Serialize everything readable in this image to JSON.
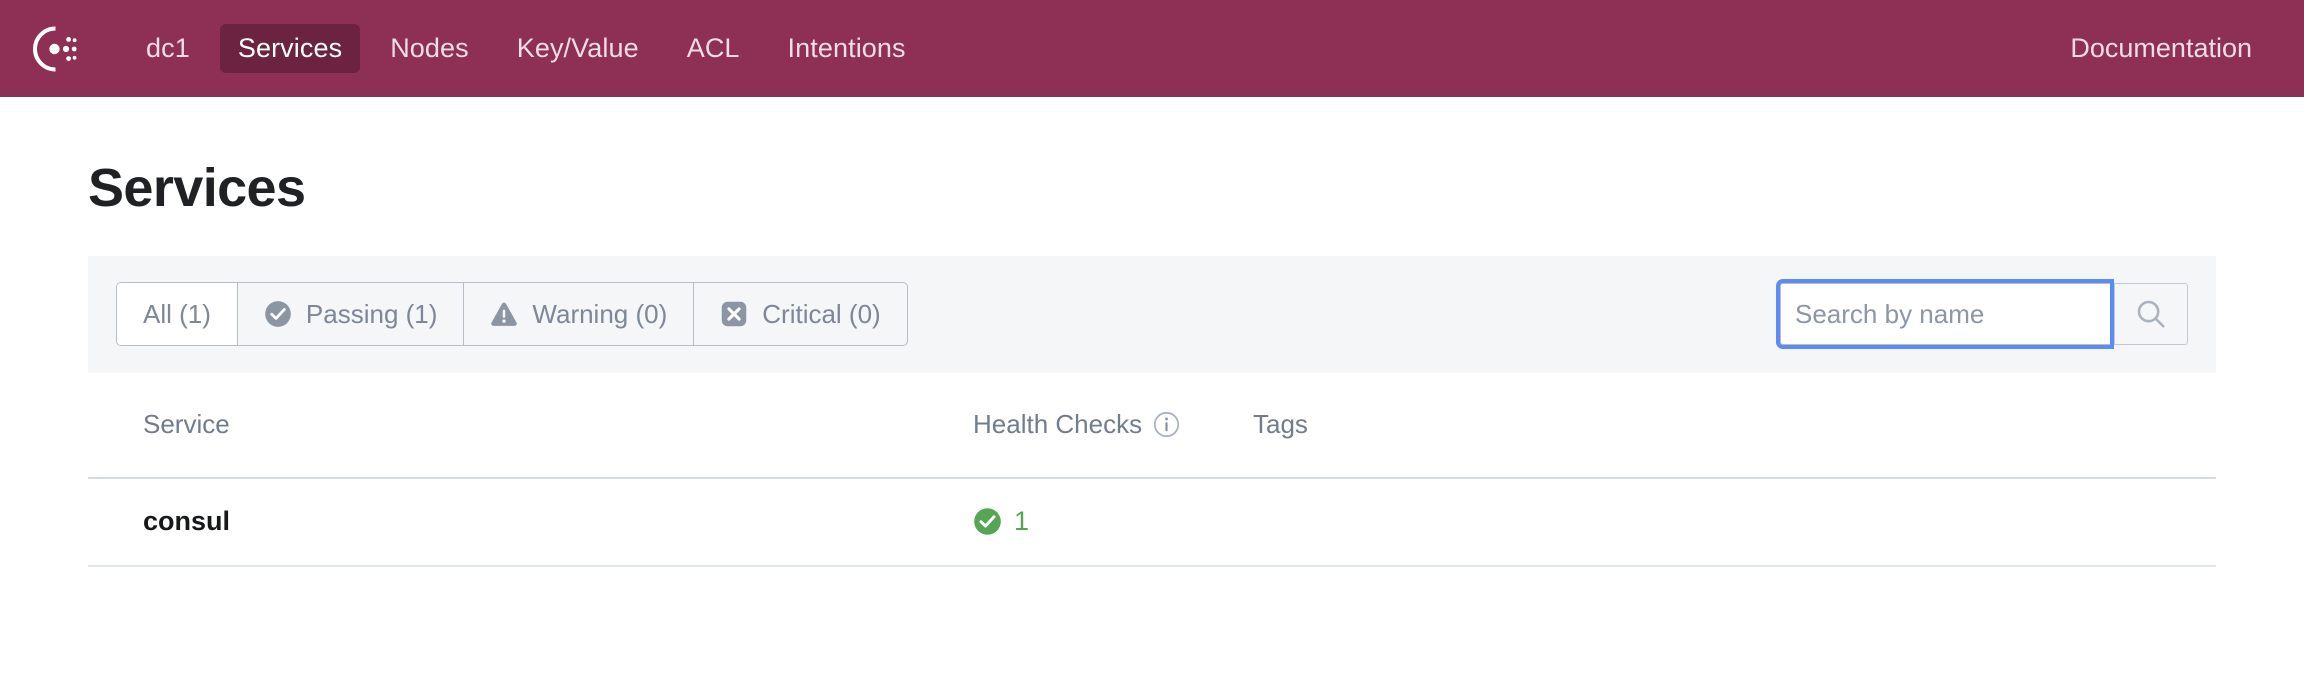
{
  "nav": {
    "logo_icon": "consul-logo-icon",
    "items": [
      {
        "label": "dc1",
        "active": false
      },
      {
        "label": "Services",
        "active": true
      },
      {
        "label": "Nodes",
        "active": false
      },
      {
        "label": "Key/Value",
        "active": false
      },
      {
        "label": "ACL",
        "active": false
      },
      {
        "label": "Intentions",
        "active": false
      }
    ],
    "documentation_label": "Documentation",
    "bar_color": "#8e2f56",
    "active_color": "#6b2341"
  },
  "page": {
    "title": "Services"
  },
  "toolbar": {
    "background": "#f4f6f8",
    "filters": [
      {
        "label": "All (1)",
        "icon": "none",
        "active": true
      },
      {
        "label": "Passing (1)",
        "icon": "check-circle-icon",
        "active": false
      },
      {
        "label": "Warning (0)",
        "icon": "warning-triangle-icon",
        "active": false
      },
      {
        "label": "Critical (0)",
        "icon": "x-square-icon",
        "active": false
      }
    ],
    "search": {
      "placeholder": "Search by name",
      "value": "",
      "focused": true,
      "focus_ring_color": "#5b8cf5",
      "button_icon": "search-icon"
    }
  },
  "table": {
    "columns": [
      {
        "key": "service",
        "label": "Service"
      },
      {
        "key": "health",
        "label": "Health Checks",
        "icon": "info-icon"
      },
      {
        "key": "tags",
        "label": "Tags"
      }
    ],
    "rows": [
      {
        "service": "consul",
        "health_status": "passing",
        "health_icon": "check-circle-green-icon",
        "health_count": "1",
        "health_color": "#55a555",
        "tags": ""
      }
    ]
  }
}
